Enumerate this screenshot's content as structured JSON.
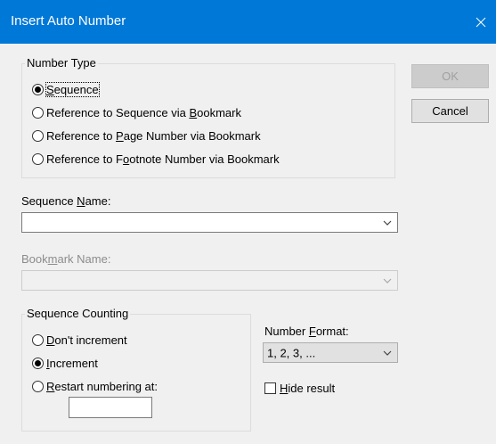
{
  "window": {
    "title": "Insert Auto Number"
  },
  "buttons": {
    "ok": "OK",
    "cancel": "Cancel"
  },
  "number_type": {
    "legend": "Number Type",
    "options": [
      {
        "pre": "",
        "key": "S",
        "post": "equence",
        "selected": true
      },
      {
        "pre": "Reference to Sequence via ",
        "key": "B",
        "post": "ookmark",
        "selected": false
      },
      {
        "pre": "Reference to ",
        "key": "P",
        "post": "age Number via Bookmark",
        "selected": false
      },
      {
        "pre": "Reference to F",
        "key": "o",
        "post": "otnote Number via Bookmark",
        "selected": false
      }
    ]
  },
  "sequence_name": {
    "pre": "Sequence ",
    "key": "N",
    "post": "ame:",
    "value": ""
  },
  "bookmark_name": {
    "pre": "Book",
    "key": "m",
    "post": "ark Name:",
    "value": ""
  },
  "sequence_counting": {
    "legend": "Sequence Counting",
    "options": [
      {
        "pre": "",
        "key": "D",
        "post": "on't increment",
        "selected": false
      },
      {
        "pre": "",
        "key": "I",
        "post": "ncrement",
        "selected": true
      },
      {
        "pre": "",
        "key": "R",
        "post": "estart numbering at:",
        "selected": false
      }
    ],
    "restart_value": ""
  },
  "number_format": {
    "pre": "Number ",
    "key": "F",
    "post": "ormat:",
    "value": "1, 2, 3, ..."
  },
  "hide_result": {
    "pre": "",
    "key": "H",
    "post": "ide result",
    "checked": false
  }
}
